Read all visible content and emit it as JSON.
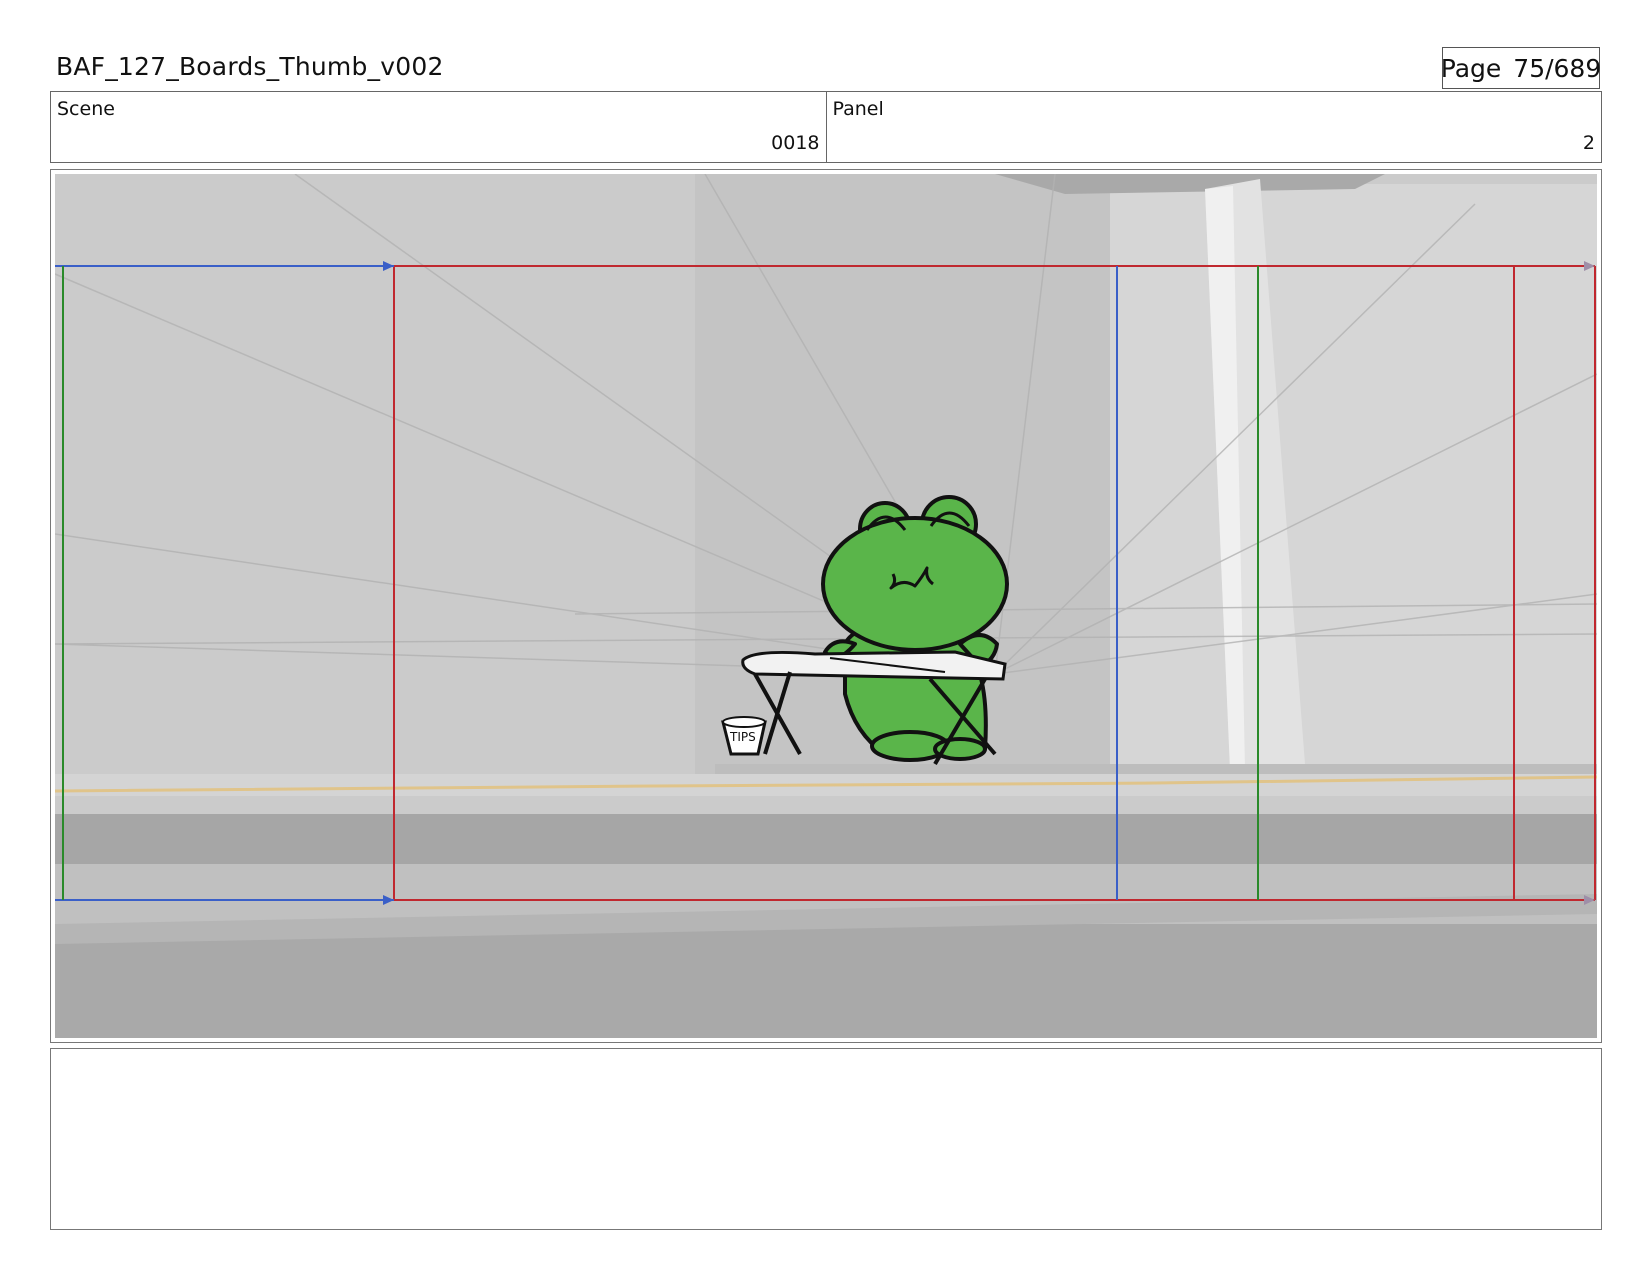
{
  "header": {
    "title": "BAF_127_Boards_Thumb_v002",
    "page_label": "Page",
    "page_value": "75/689"
  },
  "info": {
    "scene_label": "Scene",
    "scene_value": "0018",
    "panel_label": "Panel",
    "panel_value": "2"
  },
  "panel_image": {
    "tip_jar_text": "TIPS",
    "colors": {
      "frog_green": "#5ab54a",
      "safe_frame_red": "#c0282f",
      "action_blue": "#3a5fc8",
      "title_green": "#2a8a2a",
      "guide_yellow": "#e0c48a",
      "background_grey": "#c9c9c9"
    }
  },
  "notes": {
    "text": ""
  }
}
